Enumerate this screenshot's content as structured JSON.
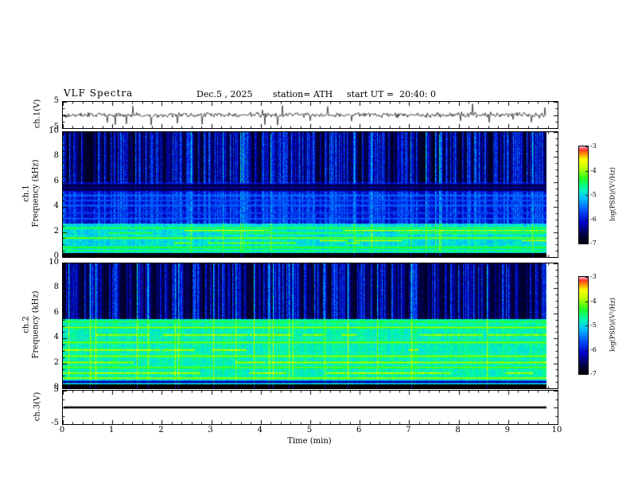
{
  "header": {
    "title": "VLF Spectra",
    "date": "Dec.5 , 2025",
    "station": "station= ATH",
    "start_ut": "start UT =  20:40: 0"
  },
  "axes": {
    "x": {
      "label": "Time (min)",
      "lim": [
        0,
        10
      ],
      "ticks": [
        0,
        1,
        2,
        3,
        4,
        5,
        6,
        7,
        8,
        9,
        10
      ]
    },
    "wave_y": {
      "lim": [
        -5,
        5
      ],
      "ticks": [
        5,
        -5
      ]
    },
    "spec_y": {
      "lim": [
        0,
        10
      ],
      "ticks": [
        0,
        2,
        4,
        6,
        8,
        10
      ]
    },
    "labels": {
      "ch1_wave": "ch.1(V)",
      "ch1_spec": [
        "ch.1",
        "Frequency (kHz)"
      ],
      "ch2_spec": [
        "ch.2",
        "Frequency (kHz)"
      ],
      "ch3_wave": "ch.3(V)"
    }
  },
  "colorbar": {
    "label": "log(PSD)/(V²/Hz)",
    "ticks": [
      -3,
      -4,
      -5,
      -6,
      -7
    ],
    "range": [
      -7,
      -3
    ],
    "palette": [
      [
        0.0,
        "#000000"
      ],
      [
        0.1,
        "#00004a"
      ],
      [
        0.22,
        "#0000c8"
      ],
      [
        0.35,
        "#0055ff"
      ],
      [
        0.47,
        "#00c3ff"
      ],
      [
        0.57,
        "#00ffb0"
      ],
      [
        0.67,
        "#22ff22"
      ],
      [
        0.78,
        "#bfff00"
      ],
      [
        0.87,
        "#ffff00"
      ],
      [
        0.93,
        "#ff8800"
      ],
      [
        0.97,
        "#ff3333"
      ],
      [
        1.0,
        "#ffb6c1"
      ]
    ]
  },
  "chart_data": [
    {
      "type": "line",
      "name": "ch1_waveform",
      "ylabel": "ch.1(V)",
      "xlim": [
        0,
        10
      ],
      "ylim": [
        -5,
        5
      ],
      "x_data_end": 9.78,
      "description": "Broadband noisy voltage waveform centered near 0 V with frequent impulsive spikes reaching about ±4 V",
      "noise_amplitude": 0.55,
      "spike_probability": 0.045,
      "spike_amplitude": 3.2,
      "seed": 101
    },
    {
      "type": "heatmap",
      "name": "ch1_spectrogram",
      "ylabel": [
        "ch.1",
        "Frequency (kHz)"
      ],
      "xlim": [
        0,
        10
      ],
      "ylim": [
        0,
        10
      ],
      "x_data_end": 9.78,
      "value_range": [
        -7,
        -3
      ],
      "seed": 202,
      "streak_density": 0.38,
      "strong_streak_probability": 0.02,
      "description": "VLF spectrogram: dark blue 6-10 kHz band with dense vertical sferic streaks, blue 3-6 kHz band with faint cyan lines, bright green/cyan 0.4-2.7 kHz band with yellow/red power-line harmonics, black band below 0.35 kHz",
      "bands": [
        {
          "f": [
            0,
            0.35
          ],
          "level": -7.0,
          "noise": 0.05,
          "streak_gain": 0.05
        },
        {
          "f": [
            0.35,
            2.7
          ],
          "level": -5.05,
          "noise": 0.3,
          "streak_gain": 0.35
        },
        {
          "f": [
            2.7,
            6.0
          ],
          "level": -6.15,
          "noise": 0.3,
          "streak_gain": 0.95
        },
        {
          "f": [
            6.0,
            10.0
          ],
          "level": -6.8,
          "noise": 0.18,
          "streak_gain": 1.7
        }
      ],
      "h_lines": [
        {
          "f": 0.55,
          "level": -4.4,
          "width": 0.05
        },
        {
          "f": 0.8,
          "level": -4.2,
          "width": 0.05
        },
        {
          "f": 1.15,
          "level": -3.8,
          "width": 0.05,
          "intermittent": true
        },
        {
          "f": 1.35,
          "level": -3.3,
          "width": 0.04,
          "intermittent": true
        },
        {
          "f": 1.55,
          "level": -4.0,
          "width": 0.05
        },
        {
          "f": 1.95,
          "level": -4.15,
          "width": 0.05,
          "intermittent": true
        },
        {
          "f": 2.15,
          "level": -3.4,
          "width": 0.04,
          "intermittent": true
        },
        {
          "f": 2.35,
          "level": -4.3,
          "width": 0.05
        },
        {
          "f": 3.1,
          "level": -5.55,
          "width": 0.05
        },
        {
          "f": 3.55,
          "level": -5.7,
          "width": 0.05
        },
        {
          "f": 4.15,
          "level": -5.5,
          "width": 0.05
        },
        {
          "f": 4.55,
          "level": -5.6,
          "width": 0.05
        },
        {
          "f": 4.95,
          "level": -5.45,
          "width": 0.05
        },
        {
          "f": 5.45,
          "level": -6.65,
          "width": 0.1
        },
        {
          "f": 5.75,
          "level": -6.7,
          "width": 0.1
        }
      ]
    },
    {
      "type": "heatmap",
      "name": "ch2_spectrogram",
      "ylabel": [
        "ch.2",
        "Frequency (kHz)"
      ],
      "xlim": [
        0,
        10
      ],
      "ylim": [
        0,
        10
      ],
      "x_data_end": 9.78,
      "value_range": [
        -7,
        -3
      ],
      "seed": 303,
      "streak_density": 0.3,
      "strong_streak_probability": 0.02,
      "description": "VLF spectrogram: dark blue 5.6-10 kHz band with vertical sferic streaks, bright green 0.4-5.6 kHz band with many yellow and intermittent red horizontal harmonic lines, black band below 0.35 kHz",
      "bands": [
        {
          "f": [
            0,
            0.35
          ],
          "level": -7.0,
          "noise": 0.05,
          "streak_gain": 0.05
        },
        {
          "f": [
            0.35,
            5.6
          ],
          "level": -4.85,
          "noise": 0.28,
          "streak_gain": 0.3
        },
        {
          "f": [
            5.6,
            10.0
          ],
          "level": -6.75,
          "noise": 0.18,
          "streak_gain": 1.6
        }
      ],
      "h_lines": [
        {
          "f": 0.55,
          "level": -6.5,
          "width": 0.07
        },
        {
          "f": 0.85,
          "level": -3.9,
          "width": 0.05
        },
        {
          "f": 1.25,
          "level": -3.5,
          "width": 0.05,
          "intermittent": true
        },
        {
          "f": 1.7,
          "level": -4.1,
          "width": 0.05
        },
        {
          "f": 2.1,
          "level": -3.5,
          "width": 0.05,
          "intermittent": true
        },
        {
          "f": 2.6,
          "level": -3.9,
          "width": 0.05
        },
        {
          "f": 3.1,
          "level": -3.45,
          "width": 0.05,
          "intermittent": true
        },
        {
          "f": 3.7,
          "level": -4.0,
          "width": 0.05
        },
        {
          "f": 4.3,
          "level": -3.6,
          "width": 0.05,
          "intermittent": true
        },
        {
          "f": 4.9,
          "level": -3.9,
          "width": 0.05
        },
        {
          "f": 5.35,
          "level": -4.3,
          "width": 0.05
        }
      ]
    },
    {
      "type": "line",
      "name": "ch3_waveform",
      "ylabel": "ch.3(V)",
      "xlim": [
        0,
        10
      ],
      "ylim": [
        -5,
        5
      ],
      "x_data_end": 9.78,
      "flat_value": 0,
      "line_width": 2.6,
      "description": "Flat thick black line at 0 V (inactive channel)",
      "seed": 404
    }
  ]
}
